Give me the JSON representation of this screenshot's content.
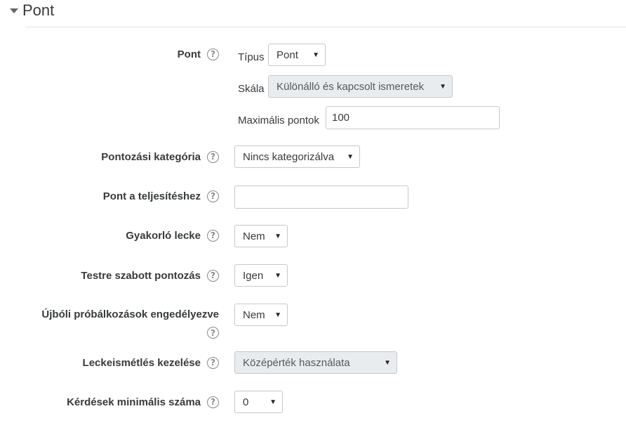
{
  "section": {
    "title": "Pont"
  },
  "pont": {
    "label": "Pont",
    "type_label": "Típus",
    "type_value": "Pont",
    "scale_label": "Skála",
    "scale_value": "Különálló és kapcsolt ismeretek",
    "max_label": "Maximális pontok",
    "max_value": "100"
  },
  "category": {
    "label": "Pontozási kategória",
    "value": "Nincs kategorizálva"
  },
  "completion": {
    "label": "Pont a teljesítéshez",
    "value": ""
  },
  "practice": {
    "label": "Gyakorló lecke",
    "value": "Nem"
  },
  "custom": {
    "label": "Testre szabott pontozás",
    "value": "Igen"
  },
  "retake": {
    "label": "Újbóli próbálkozások engedélyezve",
    "value": "Nem"
  },
  "handling": {
    "label": "Leckeismétlés kezelése",
    "value": "Középérték használata"
  },
  "minquestions": {
    "label": "Kérdések minimális száma",
    "value": "0"
  },
  "icons": {
    "help": "help-question-icon",
    "caret": "caret-down-icon",
    "dropdown": "dropdown-arrow-icon"
  }
}
